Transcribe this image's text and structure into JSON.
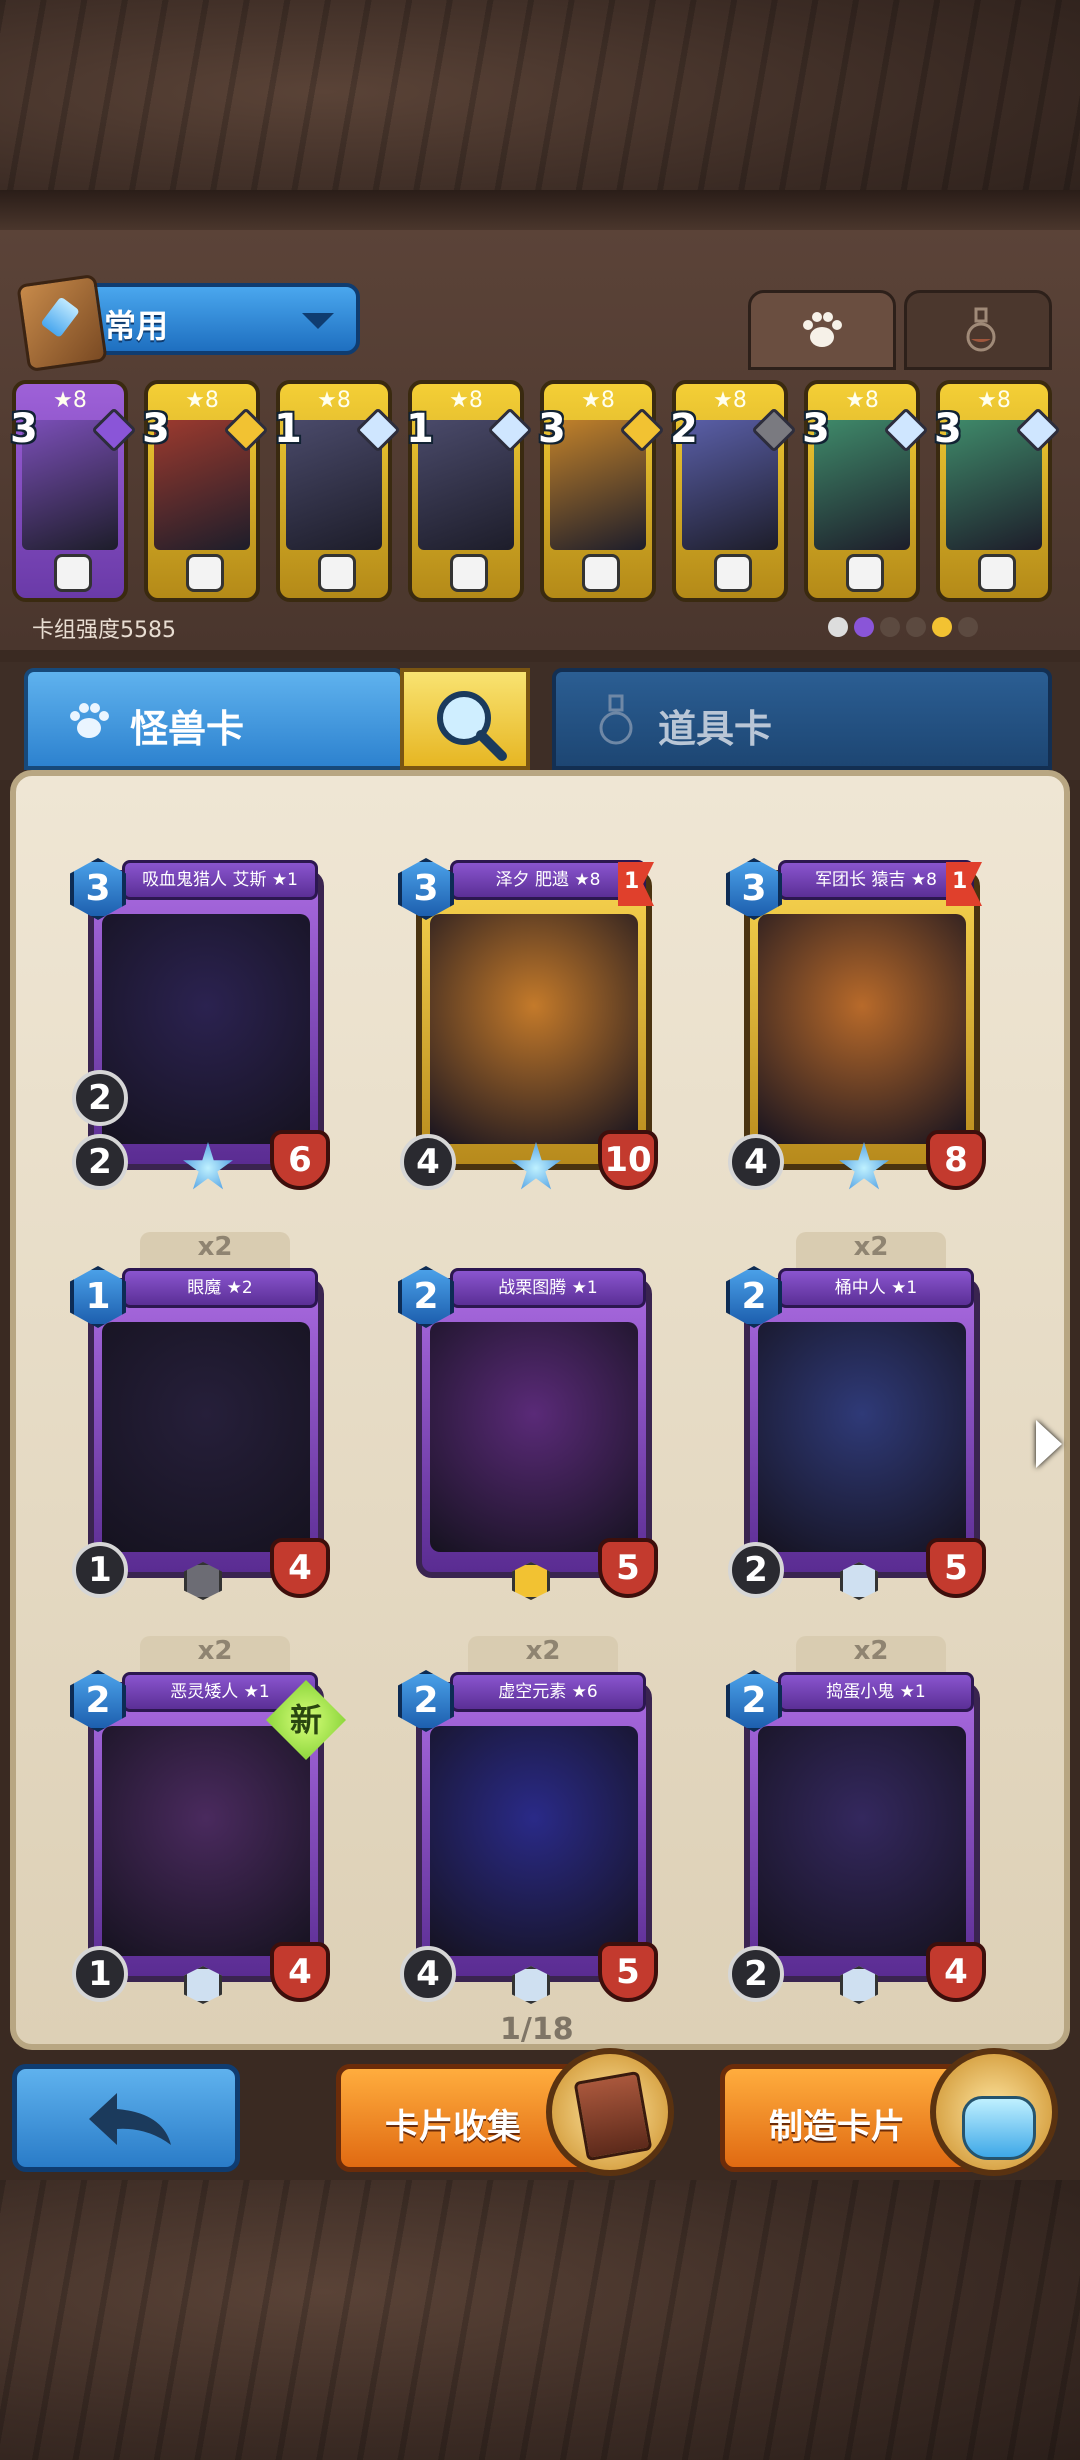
{
  "deck": {
    "name": "常用",
    "power_text": "卡组强度5585",
    "cards": [
      {
        "stars": "★8",
        "cost": "3",
        "frame": "purple",
        "gem": "purp"
      },
      {
        "stars": "★8",
        "cost": "3",
        "frame": "gold",
        "gem": "gold"
      },
      {
        "stars": "★8",
        "cost": "1",
        "frame": "gold",
        "gem": "silver"
      },
      {
        "stars": "★8",
        "cost": "1",
        "frame": "gold",
        "gem": "silver"
      },
      {
        "stars": "★8",
        "cost": "3",
        "frame": "gold",
        "gem": "gold"
      },
      {
        "stars": "★8",
        "cost": "2",
        "frame": "gold",
        "gem": "gray"
      },
      {
        "stars": "★8",
        "cost": "3",
        "frame": "gold",
        "gem": "silver"
      },
      {
        "stars": "★8",
        "cost": "3",
        "frame": "gold",
        "gem": "silver"
      }
    ]
  },
  "tabs": {
    "monster": "怪兽卡",
    "items": "道具卡"
  },
  "cards": [
    {
      "name": "吸血鬼猎人 艾斯 ★1",
      "cost": "3",
      "range": "2",
      "attack": "2",
      "hp": "6",
      "frame": "purple",
      "copies": "",
      "flag": "",
      "badge": "star"
    },
    {
      "name": "泽夕 肥遗 ★8",
      "cost": "3",
      "range": "",
      "attack": "4",
      "hp": "10",
      "frame": "gold",
      "copies": "",
      "flag": "1",
      "badge": "star"
    },
    {
      "name": "军团长 猿吉 ★8",
      "cost": "3",
      "range": "",
      "attack": "4",
      "hp": "8",
      "frame": "gold",
      "copies": "",
      "flag": "1",
      "badge": "star"
    },
    {
      "name": "眼魔 ★2",
      "cost": "1",
      "range": "",
      "attack": "1",
      "hp": "4",
      "frame": "purple",
      "copies": "x2",
      "flag": "",
      "badge": "gray"
    },
    {
      "name": "战栗图腾 ★1",
      "cost": "2",
      "range": "",
      "attack": "",
      "hp": "5",
      "frame": "purple",
      "copies": "",
      "flag": "",
      "badge": "gold"
    },
    {
      "name": "桶中人 ★1",
      "cost": "2",
      "range": "",
      "attack": "2",
      "hp": "5",
      "frame": "purple",
      "copies": "x2",
      "flag": "",
      "badge": "silver"
    },
    {
      "name": "恶灵矮人 ★1",
      "cost": "2",
      "range": "",
      "attack": "1",
      "hp": "4",
      "frame": "purple",
      "copies": "x2",
      "flag": "",
      "badge": "silver",
      "new": "新"
    },
    {
      "name": "虚空元素 ★6",
      "cost": "2",
      "range": "",
      "attack": "4",
      "hp": "5",
      "frame": "purple",
      "copies": "x2",
      "flag": "",
      "badge": "silver"
    },
    {
      "name": "捣蛋小鬼 ★1",
      "cost": "2",
      "range": "",
      "attack": "2",
      "hp": "4",
      "frame": "purple",
      "copies": "x2",
      "flag": "",
      "badge": "silver"
    }
  ],
  "page_indicator": "1/18",
  "buttons": {
    "collect": "卡片收集",
    "craft": "制造卡片"
  },
  "colors": {
    "blue_button": "#2d82cf",
    "orange_button": "#e06a12",
    "gold_frame": "#f4cf36",
    "purple_frame": "#8a55cf",
    "hp_red": "#c33a2e"
  }
}
